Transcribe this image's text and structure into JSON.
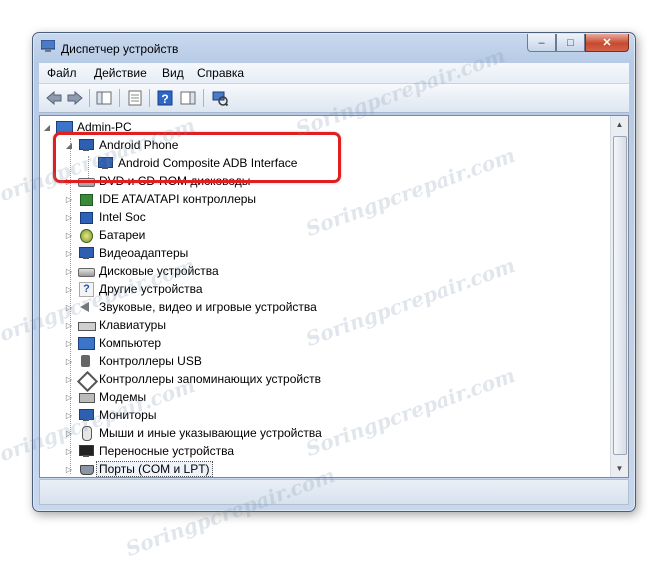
{
  "window": {
    "title": "Диспетчер устройств"
  },
  "caption_buttons": {
    "minimize": "–",
    "maximize": "□",
    "close": "✕"
  },
  "menu": [
    "Файл",
    "Действие",
    "Вид",
    "Справка"
  ],
  "toolbar_icons": [
    "back-arrow-icon",
    "forward-arrow-icon",
    "console-tree-icon",
    "properties-icon",
    "help-icon",
    "action-pane-icon",
    "scan-hardware-icon"
  ],
  "tree": {
    "root": "Admin-PC",
    "android": {
      "label": "Android Phone",
      "child": "Android Composite ADB Interface"
    },
    "partial_hidden": "DVD и CD-ROM дисководы",
    "categories": [
      "IDE ATA/ATAPI контроллеры",
      "Intel Soc",
      "Батареи",
      "Видеоадаптеры",
      "Дисковые устройства",
      "Другие устройства",
      "Звуковые, видео и игровые устройства",
      "Клавиатуры",
      "Компьютер",
      "Контроллеры USB",
      "Контроллеры запоминающих устройств",
      "Модемы",
      "Мониторы",
      "Мыши и иные указывающие устройства",
      "Переносные устройства",
      "Порты (COM и LPT)"
    ]
  },
  "watermark": "Soringpcrepair.com",
  "colors": {
    "highlight": "#e02020",
    "title_bg": "#b9cde7"
  }
}
